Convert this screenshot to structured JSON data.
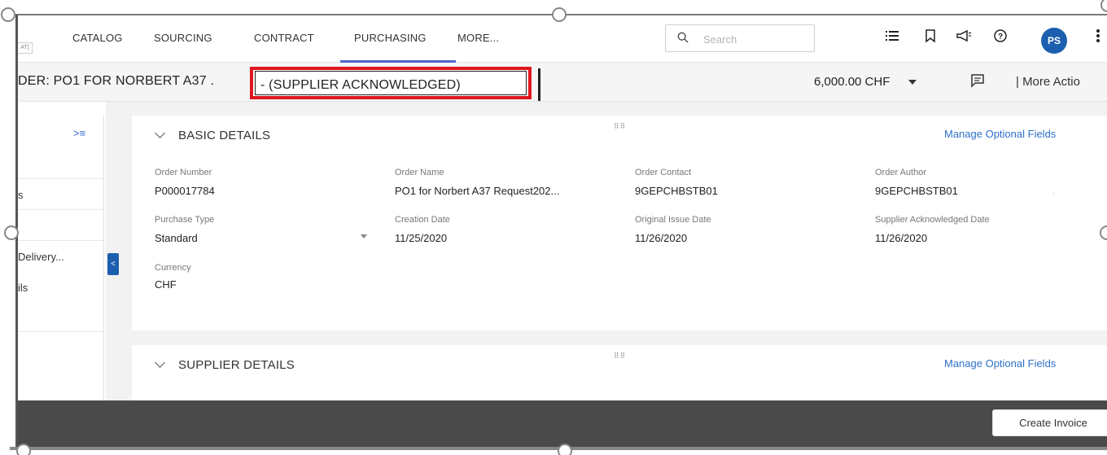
{
  "nav": {
    "brand_chip": "AT]",
    "items": [
      {
        "label": "CATALOG"
      },
      {
        "label": "SOURCING"
      },
      {
        "label": "CONTRACT"
      },
      {
        "label": "PURCHASING"
      },
      {
        "label": "MORE..."
      }
    ],
    "active_index": 3,
    "search_placeholder": "Search",
    "icons": [
      "list-icon",
      "bookmark-icon",
      "megaphone-icon",
      "help-icon",
      "kebab-menu-icon"
    ],
    "avatar_initials": "PS"
  },
  "header": {
    "title": "DER: PO1 FOR NORBERT A37 .",
    "status": "- (SUPPLIER ACKNOWLEDGED)",
    "amount": "6,000.00 CHF",
    "more_actions": "| More Actio"
  },
  "sidebar": {
    "toggle": ">≡",
    "items": [
      {
        "label": ""
      },
      {
        "label": "s"
      },
      {
        "label": ""
      },
      {
        "label": "Delivery..."
      },
      {
        "label": "ils"
      }
    ]
  },
  "sections": {
    "basic": {
      "title": "BASIC DETAILS",
      "manage_link": "Manage Optional Fields",
      "fields": {
        "order_number": {
          "label": "Order Number",
          "value": "P000017784"
        },
        "order_name": {
          "label": "Order Name",
          "value": "PO1 for Norbert A37 Request202..."
        },
        "order_contact": {
          "label": "Order Contact",
          "value": "9GEPCHBSTB01"
        },
        "order_author": {
          "label": "Order Author",
          "value": "9GEPCHBSTB01"
        },
        "purchase_type": {
          "label": "Purchase Type",
          "value": "Standard"
        },
        "creation_date": {
          "label": "Creation Date",
          "value": "11/25/2020"
        },
        "original_issue_date": {
          "label": "Original Issue Date",
          "value": "11/26/2020"
        },
        "supplier_ack_date": {
          "label": "Supplier Acknowledged Date",
          "value": "11/26/2020"
        },
        "currency": {
          "label": "Currency",
          "value": "CHF"
        }
      }
    },
    "supplier": {
      "title": "SUPPLIER DETAILS",
      "manage_link": "Manage Optional Fields"
    }
  },
  "footer": {
    "create_invoice": "Create Invoice"
  },
  "colors": {
    "accent": "#4d67c9",
    "link": "#2e72c9",
    "avatar": "#1b5fae",
    "highlight_border": "#e0161e",
    "bottom_bar": "#4a4a4a"
  }
}
